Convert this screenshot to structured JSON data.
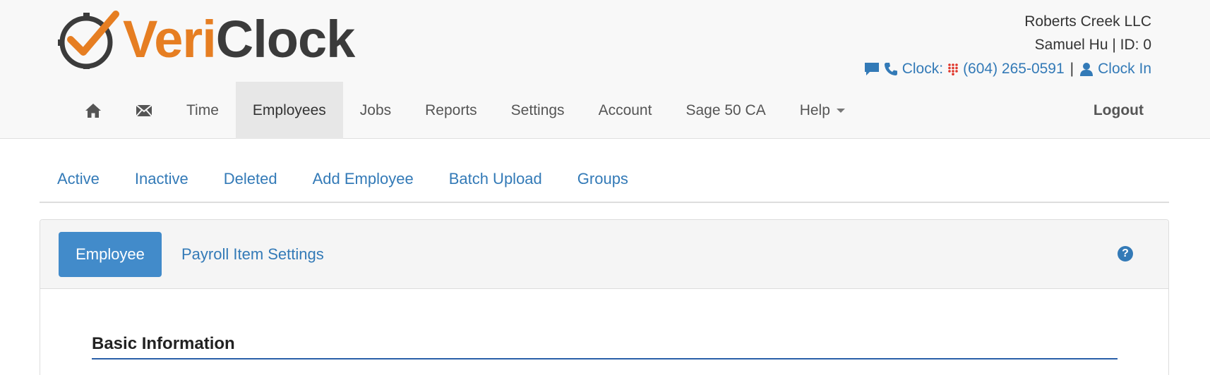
{
  "brand": {
    "logo_part1": "Veri",
    "logo_part2": "Clock"
  },
  "account": {
    "company": "Roberts Creek LLC",
    "user_line": "Samuel Hu | ID: 0"
  },
  "clockbar": {
    "clock_label": "Clock:",
    "phone": "(604) 265-0591",
    "separator": "|",
    "clock_in": "Clock In"
  },
  "nav": {
    "time": "Time",
    "employees": "Employees",
    "jobs": "Jobs",
    "reports": "Reports",
    "settings": "Settings",
    "account": "Account",
    "sage": "Sage 50 CA",
    "help": "Help",
    "logout": "Logout"
  },
  "subnav": {
    "active": "Active",
    "inactive": "Inactive",
    "deleted": "Deleted",
    "add_employee": "Add Employee",
    "batch_upload": "Batch Upload",
    "groups": "Groups"
  },
  "panel": {
    "tab_employee": "Employee",
    "tab_payroll": "Payroll Item Settings",
    "help_glyph": "?",
    "section_title": "Basic Information"
  },
  "colors": {
    "link": "#337ab7",
    "brand_orange": "#e67e22",
    "pill_blue": "#428bca",
    "active_nav_bg": "#e7e7e7"
  },
  "icons": [
    "home-icon",
    "envelope-icon",
    "comment-icon",
    "phone-icon",
    "keypad-icon",
    "user-icon",
    "caret-down-icon",
    "question-circle-icon"
  ]
}
